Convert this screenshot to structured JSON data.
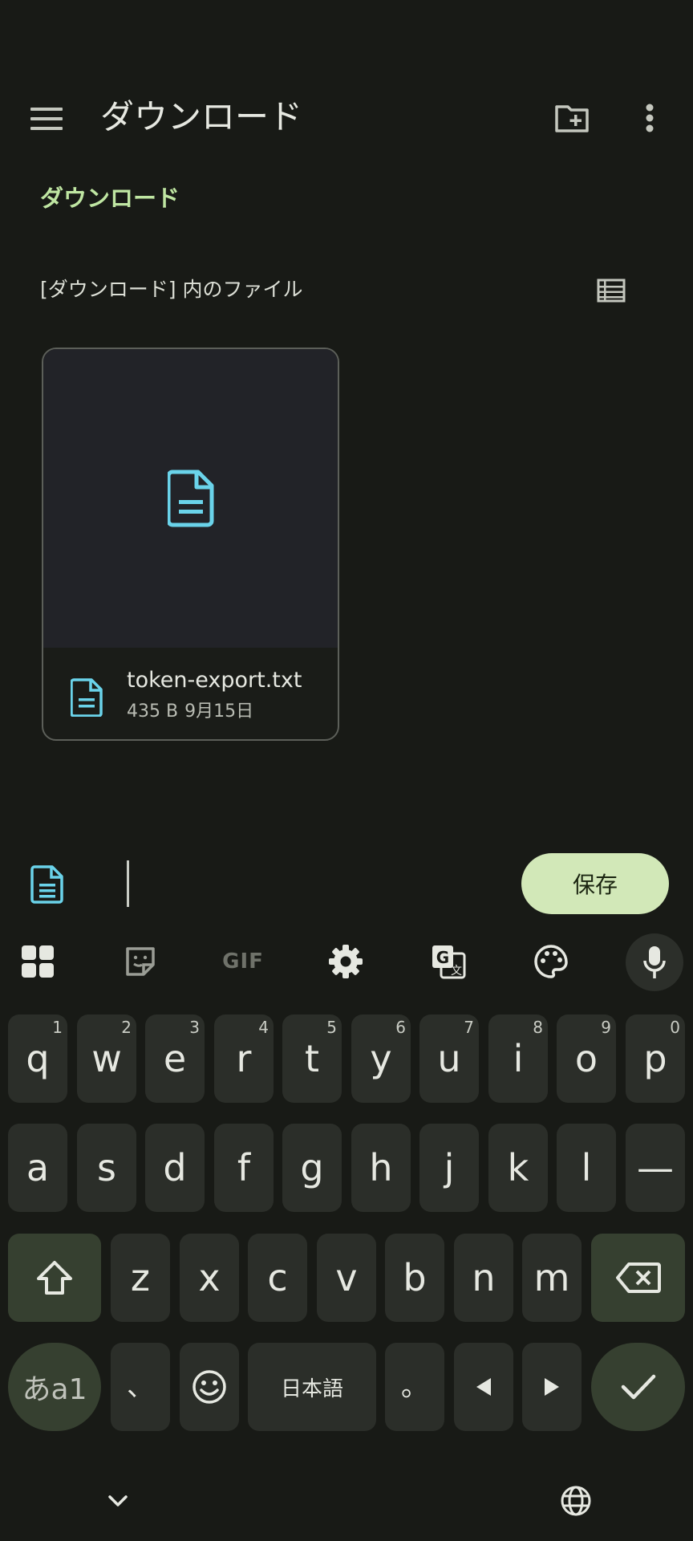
{
  "appbar": {
    "title": "ダウンロード",
    "menu_icon": "hamburger-menu-icon",
    "new_folder_icon": "create-new-folder-icon",
    "more_icon": "more-vert-icon"
  },
  "breadcrumb": "ダウンロード",
  "section": {
    "title": "[ダウンロード] 内のファイル",
    "view_toggle_icon": "list-view-icon"
  },
  "file": {
    "name": "token-export.txt",
    "size": "435 B",
    "date": "9月15日",
    "icon": "text-document-icon"
  },
  "savebar": {
    "save_label": "保存",
    "doc_icon": "document-icon"
  },
  "keyboard": {
    "toolbar": [
      "apps-grid-icon",
      "sticker-icon",
      "gif-icon",
      "settings-gear-icon",
      "translate-icon",
      "palette-icon",
      "microphone-icon"
    ],
    "gif_label": "GIF",
    "row1": [
      {
        "ch": "q",
        "hint": "1"
      },
      {
        "ch": "w",
        "hint": "2"
      },
      {
        "ch": "e",
        "hint": "3"
      },
      {
        "ch": "r",
        "hint": "4"
      },
      {
        "ch": "t",
        "hint": "5"
      },
      {
        "ch": "y",
        "hint": "6"
      },
      {
        "ch": "u",
        "hint": "7"
      },
      {
        "ch": "i",
        "hint": "8"
      },
      {
        "ch": "o",
        "hint": "9"
      },
      {
        "ch": "p",
        "hint": "0"
      }
    ],
    "row2": [
      "a",
      "s",
      "d",
      "f",
      "g",
      "h",
      "j",
      "k",
      "l",
      "—"
    ],
    "row3": [
      "z",
      "x",
      "c",
      "v",
      "b",
      "n",
      "m"
    ],
    "lang_switch": "あa1",
    "comma": "、",
    "space_label": "日本語",
    "period": "。",
    "accent_color": "#6ad3ea"
  },
  "navbar": {
    "hide_keyboard_icon": "chevron-down-icon",
    "language_icon": "globe-icon"
  }
}
